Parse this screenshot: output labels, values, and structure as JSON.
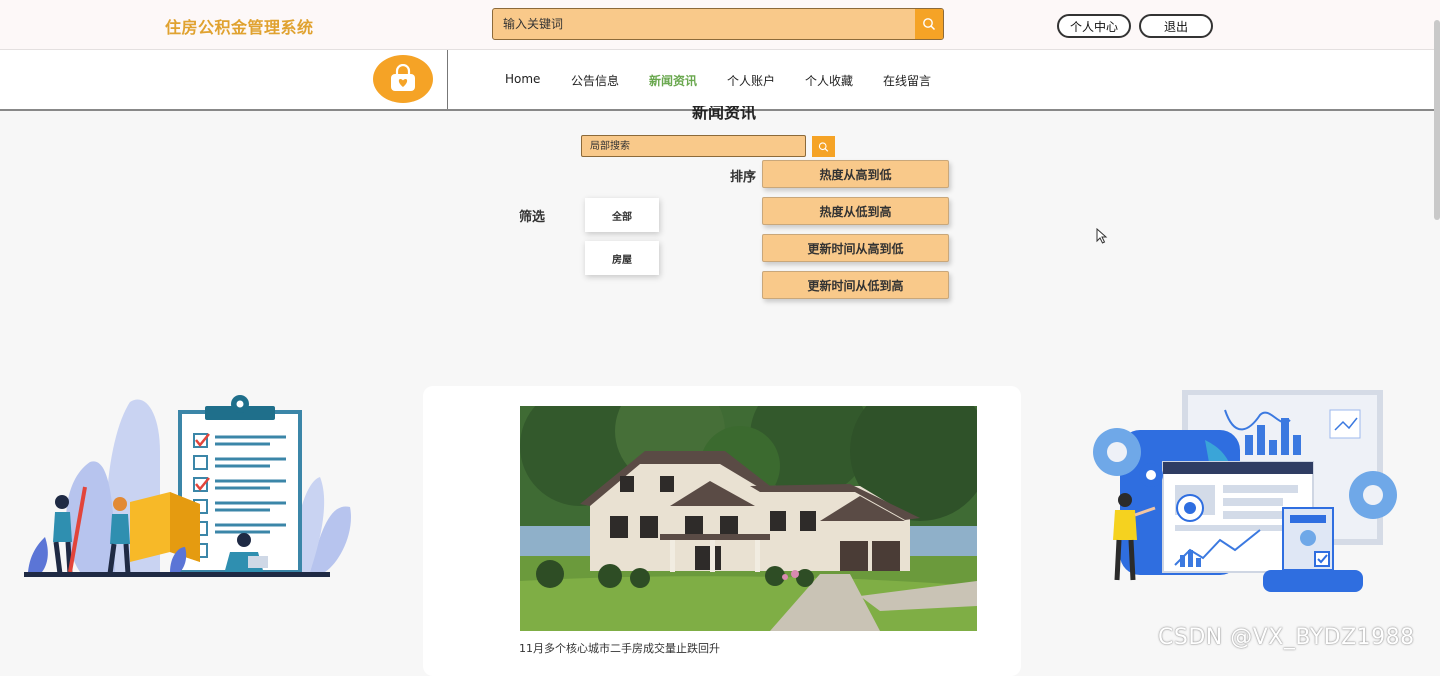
{
  "header": {
    "site_title": "住房公积金管理系统",
    "search_placeholder": "输入关键词",
    "personal_center_label": "个人中心",
    "logout_label": "退出"
  },
  "nav": {
    "items": [
      {
        "label": "Home",
        "active": false
      },
      {
        "label": "公告信息",
        "active": false
      },
      {
        "label": "新闻资讯",
        "active": true
      },
      {
        "label": "个人账户",
        "active": false
      },
      {
        "label": "个人收藏",
        "active": false
      },
      {
        "label": "在线留言",
        "active": false
      }
    ]
  },
  "main": {
    "section_title": "新闻资讯",
    "local_search_placeholder": "局部搜索",
    "sort_label": "排序",
    "sort_options": [
      "热度从高到低",
      "热度从低到高",
      "更新时间从高到低",
      "更新时间从低到高"
    ],
    "filter_label": "筛选",
    "filter_options": [
      "全部",
      "房屋"
    ],
    "news": [
      {
        "title": "11月多个核心城市二手房成交量止跌回升"
      }
    ]
  },
  "watermark": "CSDN @VX_BYDZ1988",
  "colors": {
    "accent": "#f5a326",
    "accent_light": "#f9c98a",
    "title_gold": "#e0a230",
    "nav_active": "#6aa84f"
  }
}
